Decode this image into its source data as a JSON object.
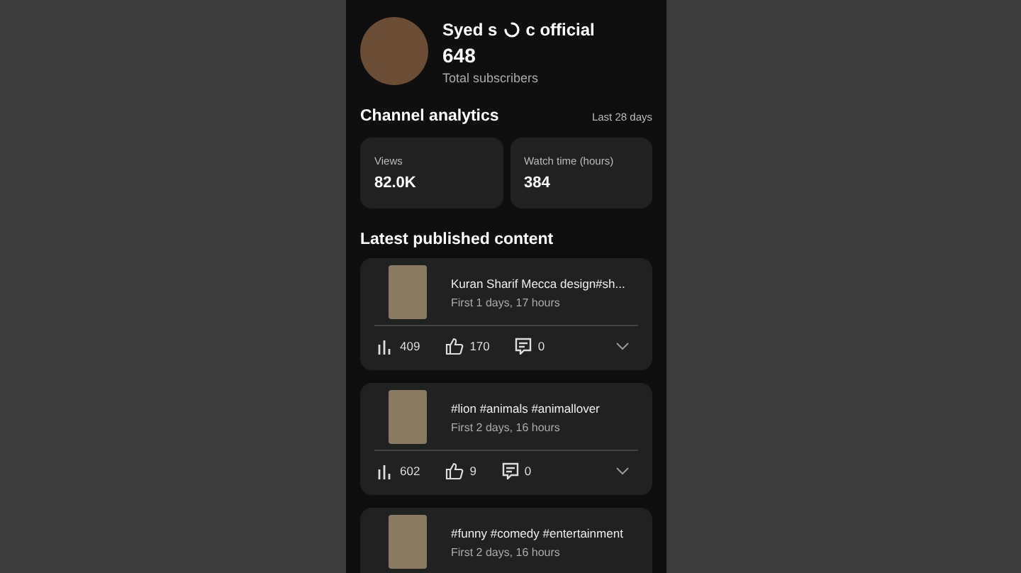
{
  "channel": {
    "name_before_spinner": "Syed s",
    "name_after_spinner": "c official",
    "subscribers": "648",
    "subscribers_label": "Total subscribers"
  },
  "analytics": {
    "title": "Channel analytics",
    "period": "Last 28 days",
    "stats": [
      {
        "label": "Views",
        "value": "82.0K"
      },
      {
        "label": "Watch time (hours)",
        "value": "384"
      }
    ]
  },
  "latest": {
    "title": "Latest published content",
    "items": [
      {
        "title": "Kuran Sharif Mecca design#sh...",
        "age": "First 1 days, 17 hours",
        "views": "409",
        "likes": "170",
        "comments": "0"
      },
      {
        "title": "#lion #animals #animallover",
        "age": "First 2 days, 16 hours",
        "views": "602",
        "likes": "9",
        "comments": "0"
      },
      {
        "title": "#funny #comedy #entertainment",
        "age": "First 2 days, 16 hours"
      }
    ]
  }
}
